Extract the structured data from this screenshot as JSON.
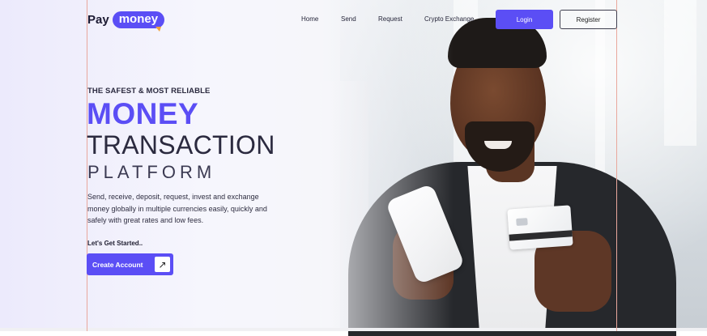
{
  "brand": {
    "pay": "Pay",
    "money": "money"
  },
  "nav": {
    "items": [
      {
        "label": "Home"
      },
      {
        "label": "Send"
      },
      {
        "label": "Request"
      },
      {
        "label": "Crypto Exchange"
      }
    ],
    "login_label": "Login",
    "register_label": "Register"
  },
  "hero": {
    "kicker": "THE SAFEST & MOST RELIABLE",
    "title_line1": "MONEY",
    "title_line2": "TRANSACTION",
    "title_line3": "PLATFORM",
    "description": "Send, receive, deposit, request, invest and exchange money globally in multiple currencies easily, quickly and safely with great rates and low fees.",
    "cta_intro": "Let's Get Started..",
    "cta_label": "Create Account",
    "cta_icon": "arrow-up-right-icon"
  },
  "colors": {
    "accent": "#5b4ef5",
    "text_dark": "#2b2a3f",
    "logo_tip": "#f2a33a"
  }
}
